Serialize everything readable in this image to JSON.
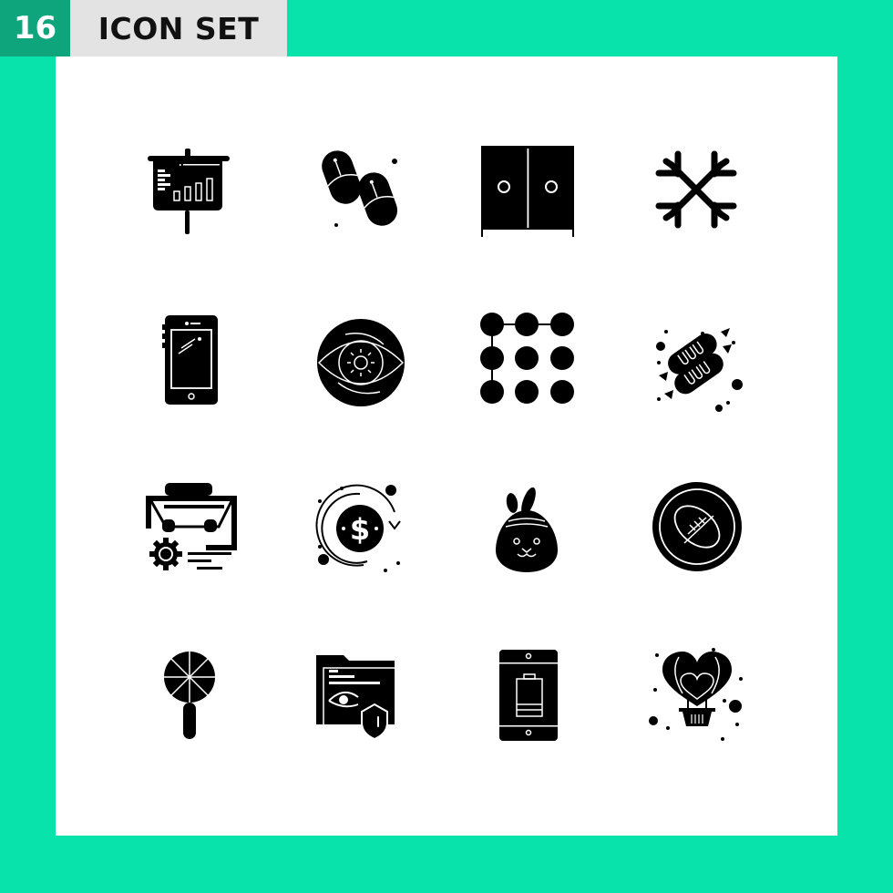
{
  "header": {
    "count": "16",
    "title": "ICON SET"
  },
  "colors": {
    "background": "#07e3ab",
    "count_badge": "#0ea57d",
    "title_badge": "#e3e3e3",
    "panel": "#ffffff",
    "icon": "#000000"
  },
  "icons": [
    {
      "name": "presentation-board-icon"
    },
    {
      "name": "flip-flops-icon"
    },
    {
      "name": "wardrobe-icon"
    },
    {
      "name": "snowflake-icon"
    },
    {
      "name": "smartphone-icon"
    },
    {
      "name": "eye-vision-icon"
    },
    {
      "name": "pattern-lock-icon"
    },
    {
      "name": "sausages-icon"
    },
    {
      "name": "briefcase-settings-icon"
    },
    {
      "name": "dollar-exchange-icon"
    },
    {
      "name": "easter-egg-bunny-icon"
    },
    {
      "name": "rugby-ball-badge-icon"
    },
    {
      "name": "lollipop-icon"
    },
    {
      "name": "secure-folder-icon"
    },
    {
      "name": "phone-battery-icon"
    },
    {
      "name": "heart-balloon-icon"
    }
  ]
}
